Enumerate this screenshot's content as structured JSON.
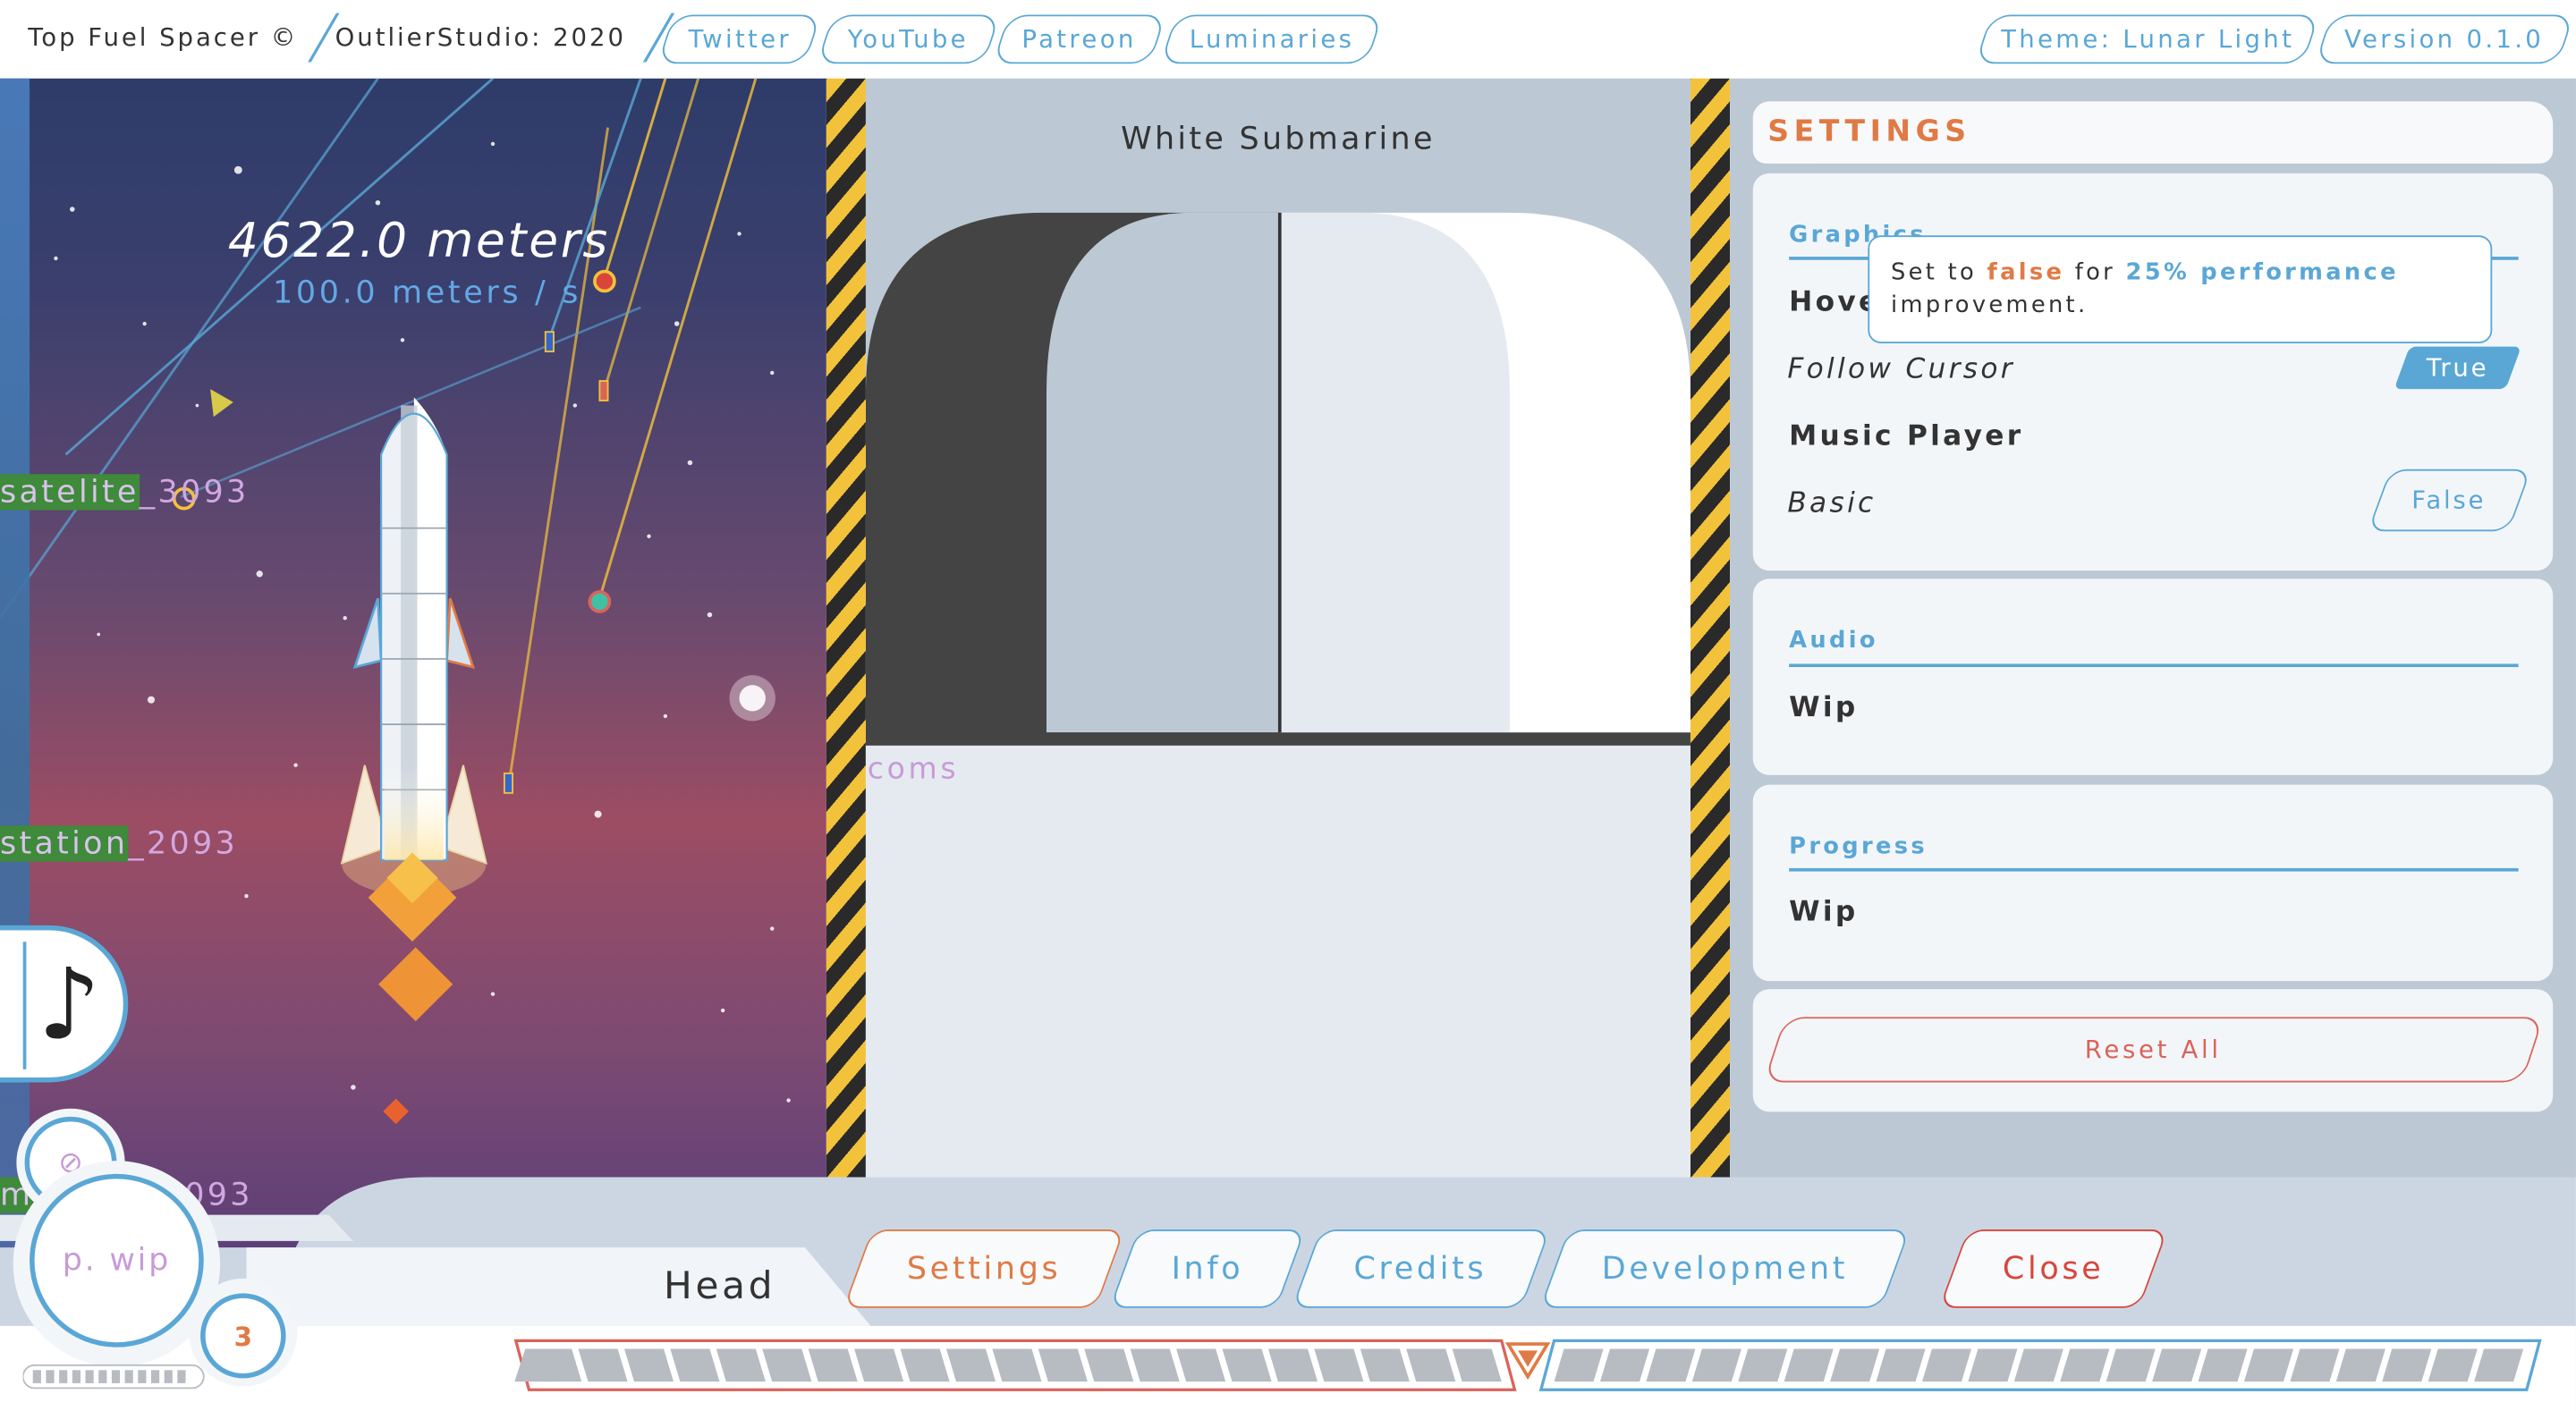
{
  "topbar": {
    "app_title": "Top Fuel Spacer ©",
    "studio": "OutlierStudio: 2020",
    "links": [
      "Twitter",
      "YouTube",
      "Patreon",
      "Luminaries"
    ],
    "theme": "Theme: Lunar Light",
    "version": "Version 0.1.0"
  },
  "game": {
    "distance": "4622.0 meters",
    "speed": "100.0 meters / s",
    "labels": {
      "satellite_highlight": "satelite",
      "satellite_rest": "_3093",
      "station_highlight": "station",
      "station_rest": "_2093",
      "third_highlight": "m",
      "third_rest": "093"
    }
  },
  "player": {
    "music_note_icon": "♪",
    "slot_symbol": "⊘",
    "profile": "p. wip",
    "count": "3"
  },
  "vehicle": {
    "title": "White Submarine",
    "coms": "coms"
  },
  "settings": {
    "title": "SETTINGS",
    "graphics": {
      "title": "Graphics",
      "hover_label": "Hove",
      "follow_cursor": "Follow Cursor",
      "follow_cursor_value": "True",
      "music_player": "Music Player",
      "basic": "Basic",
      "basic_value": "False"
    },
    "tooltip": {
      "pre": "Set to",
      "keyword": "false",
      "mid": "for",
      "highlight": "25% performance",
      "post": "improvement."
    },
    "audio": {
      "title": "Audio",
      "value": "Wip"
    },
    "progress": {
      "title": "Progress",
      "value": "Wip"
    },
    "reset": "Reset All"
  },
  "bottom": {
    "head": "Head",
    "tabs": [
      "Settings",
      "Info",
      "Credits",
      "Development",
      "Close"
    ]
  },
  "colors": {
    "accent_blue": "#5aa7d6",
    "accent_orange": "#e07a45",
    "danger_red": "#d9645b",
    "hazard_yellow": "#f3c23b"
  }
}
